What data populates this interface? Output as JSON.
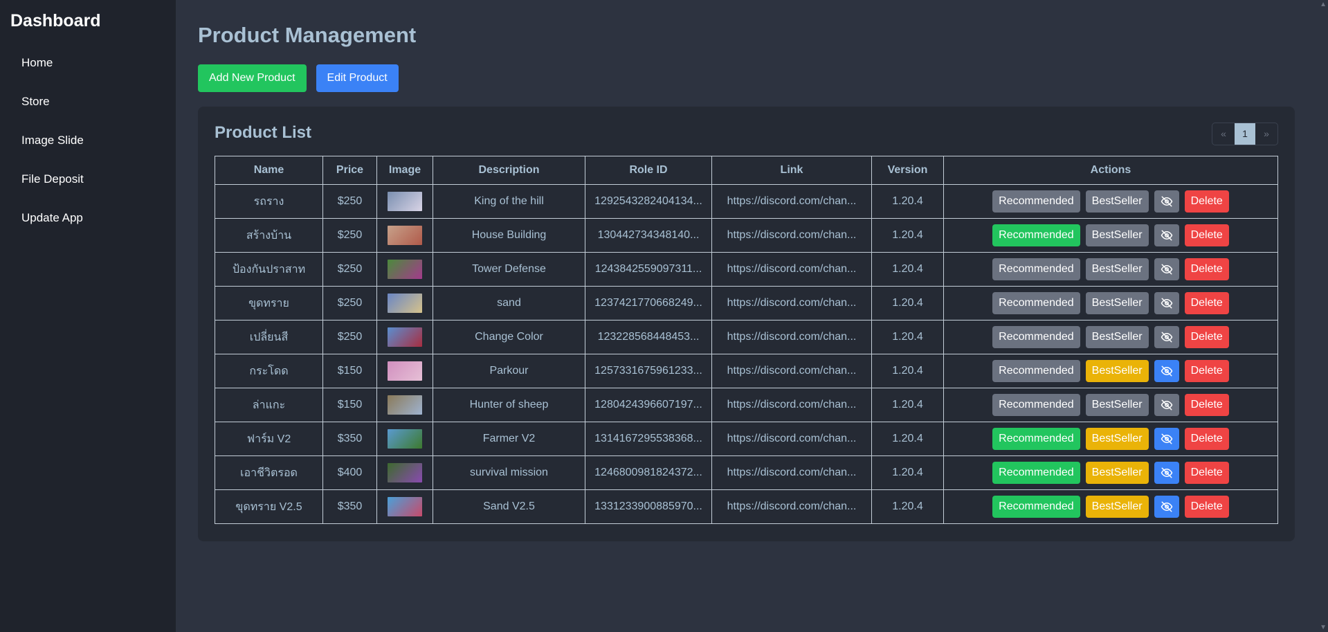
{
  "sidebar": {
    "title": "Dashboard",
    "items": [
      {
        "label": "Home"
      },
      {
        "label": "Store"
      },
      {
        "label": "Image Slide"
      },
      {
        "label": "File Deposit"
      },
      {
        "label": "Update App"
      }
    ]
  },
  "main": {
    "title": "Product Management",
    "add_label": "Add New Product",
    "edit_label": "Edit Product"
  },
  "card": {
    "title": "Product List",
    "pager": {
      "prev": "«",
      "current": "1",
      "next": "»"
    }
  },
  "table": {
    "headers": [
      "Name",
      "Price",
      "Image",
      "Description",
      "Role ID",
      "Link",
      "Version",
      "Actions"
    ],
    "action_labels": {
      "recommended": "Recommended",
      "bestseller": "BestSeller",
      "delete": "Delete"
    },
    "rows": [
      {
        "name": "รถราง",
        "price": "$250",
        "description": "King of the hill",
        "role_id": "1292543282404134...",
        "link": "https://discord.com/chan...",
        "version": "1.20.4",
        "recommended": false,
        "bestseller": false,
        "visible": false,
        "thumb": [
          "#7a8fb0",
          "#d9d4e6"
        ]
      },
      {
        "name": "สร้างบ้าน",
        "price": "$250",
        "description": "House Building",
        "role_id": "130442734348140...",
        "link": "https://discord.com/chan...",
        "version": "1.20.4",
        "recommended": true,
        "bestseller": false,
        "visible": false,
        "thumb": [
          "#c7a18a",
          "#b05a4a"
        ]
      },
      {
        "name": "ป้องกันปราสาท",
        "price": "$250",
        "description": "Tower Defense",
        "role_id": "1243842559097311...",
        "link": "https://discord.com/chan...",
        "version": "1.20.4",
        "recommended": false,
        "bestseller": false,
        "visible": false,
        "thumb": [
          "#4b8a3c",
          "#a43a8c"
        ]
      },
      {
        "name": "ขุดทราย",
        "price": "$250",
        "description": "sand",
        "role_id": "1237421770668249...",
        "link": "https://discord.com/chan...",
        "version": "1.20.4",
        "recommended": false,
        "bestseller": false,
        "visible": false,
        "thumb": [
          "#6a86c4",
          "#d6c28b"
        ]
      },
      {
        "name": "เปลี่ยนสี",
        "price": "$250",
        "description": "Change Color",
        "role_id": "123228568448453...",
        "link": "https://discord.com/chan...",
        "version": "1.20.4",
        "recommended": false,
        "bestseller": false,
        "visible": false,
        "thumb": [
          "#5a8ed0",
          "#a82d40"
        ]
      },
      {
        "name": "กระโดด",
        "price": "$150",
        "description": "Parkour",
        "role_id": "1257331675961233...",
        "link": "https://discord.com/chan...",
        "version": "1.20.4",
        "recommended": false,
        "bestseller": true,
        "visible": true,
        "thumb": [
          "#d18fbf",
          "#e6c0d6"
        ]
      },
      {
        "name": "ล่าแกะ",
        "price": "$150",
        "description": "Hunter of sheep",
        "role_id": "1280424396607197...",
        "link": "https://discord.com/chan...",
        "version": "1.20.4",
        "recommended": false,
        "bestseller": false,
        "visible": false,
        "thumb": [
          "#8a7a5a",
          "#9fb3d0"
        ]
      },
      {
        "name": "ฟาร์ม V2",
        "price": "$350",
        "description": "Farmer V2",
        "role_id": "1314167295538368...",
        "link": "https://discord.com/chan...",
        "version": "1.20.4",
        "recommended": true,
        "bestseller": true,
        "visible": true,
        "thumb": [
          "#5a9ad0",
          "#3d7a2e"
        ]
      },
      {
        "name": "เอาชีวิตรอด",
        "price": "$400",
        "description": "survival mission",
        "role_id": "1246800981824372...",
        "link": "https://discord.com/chan...",
        "version": "1.20.4",
        "recommended": true,
        "bestseller": true,
        "visible": true,
        "thumb": [
          "#3d6a2e",
          "#8a4ab0"
        ]
      },
      {
        "name": "ขุดทราย V2.5",
        "price": "$350",
        "description": "Sand V2.5",
        "role_id": "1331233900885970...",
        "link": "https://discord.com/chan...",
        "version": "1.20.4",
        "recommended": true,
        "bestseller": true,
        "visible": true,
        "thumb": [
          "#4aa0d8",
          "#c84a6a"
        ]
      }
    ]
  },
  "colors": {
    "green": "#22c55e",
    "blue": "#3b82f6",
    "gray": "#6b7280",
    "yellow": "#eab308",
    "red": "#ef4444"
  }
}
